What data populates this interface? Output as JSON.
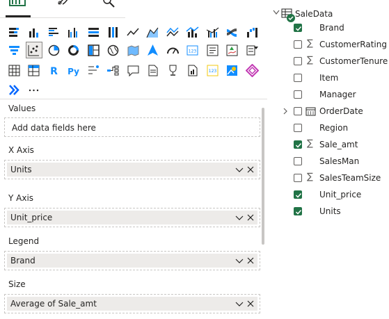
{
  "visualizations_pane": {
    "top_tabs": [
      {
        "icon": "build-visual-icon",
        "active": true
      },
      {
        "icon": "format-visual-icon",
        "active": false
      },
      {
        "icon": "analytics-icon",
        "active": false
      }
    ],
    "visual_icons": [
      [
        "stacked-bar-chart-icon",
        "stacked-column-chart-icon",
        "clustered-bar-chart-icon",
        "clustered-column-chart-icon",
        "100-stacked-bar-chart-icon",
        "100-stacked-column-chart-icon",
        "line-chart-icon",
        "area-chart-icon",
        "stacked-area-chart-icon",
        "line-and-stacked-column-icon",
        "line-and-clustered-column-icon",
        "ribbon-chart-icon",
        "waterfall-chart-icon"
      ],
      [
        "funnel-chart-icon",
        "scatter-chart-icon",
        "pie-chart-icon",
        "donut-chart-icon",
        "treemap-icon",
        "map-icon",
        "filled-map-icon",
        "azure-map-icon",
        "gauge-icon",
        "card-icon",
        "multi-row-card-icon",
        "kpi-icon",
        "slicer-icon"
      ],
      [
        "table-icon",
        "matrix-icon",
        "r-visual-icon",
        "python-visual-icon",
        "key-influencers-icon",
        "decomposition-tree-icon",
        "qa-icon",
        "smart-narrative-icon",
        "metrics-icon",
        "paginated-report-icon",
        "new-card-icon",
        "arcgis-map-icon",
        "power-apps-icon"
      ],
      [
        "power-automate-icon",
        "more-visuals-icon"
      ]
    ],
    "selected_visual": "scatter-chart-icon",
    "wells": {
      "values": {
        "label": "Values",
        "placeholder": "Add data fields here"
      },
      "x_axis": {
        "label": "X Axis",
        "field": "Units"
      },
      "y_axis": {
        "label": "Y Axis",
        "field": "Unit_price"
      },
      "legend": {
        "label": "Legend",
        "field": "Brand"
      },
      "size": {
        "label": "Size",
        "field": "Average of Sale_amt"
      }
    },
    "colors": {
      "accent_green": "#217346",
      "pill_bg": "#edebe9"
    }
  },
  "data_pane": {
    "table": {
      "name": "SaleData",
      "expanded": true,
      "has_selected_fields": true
    },
    "fields": [
      {
        "name": "Brand",
        "checked": true,
        "sigma": false,
        "expandable": false
      },
      {
        "name": "CustomerRating",
        "checked": false,
        "sigma": true,
        "expandable": false
      },
      {
        "name": "CustomerTenure",
        "checked": false,
        "sigma": true,
        "expandable": false
      },
      {
        "name": "Item",
        "checked": false,
        "sigma": false,
        "expandable": false
      },
      {
        "name": "Manager",
        "checked": false,
        "sigma": false,
        "expandable": false
      },
      {
        "name": "OrderDate",
        "checked": false,
        "sigma": false,
        "expandable": true,
        "calendar": true
      },
      {
        "name": "Region",
        "checked": false,
        "sigma": false,
        "expandable": false
      },
      {
        "name": "Sale_amt",
        "checked": true,
        "sigma": true,
        "expandable": false
      },
      {
        "name": "SalesMan",
        "checked": false,
        "sigma": false,
        "expandable": false
      },
      {
        "name": "SalesTeamSize",
        "checked": false,
        "sigma": true,
        "expandable": false
      },
      {
        "name": "Unit_price",
        "checked": true,
        "sigma": false,
        "expandable": false
      },
      {
        "name": "Units",
        "checked": true,
        "sigma": false,
        "expandable": false
      }
    ]
  }
}
